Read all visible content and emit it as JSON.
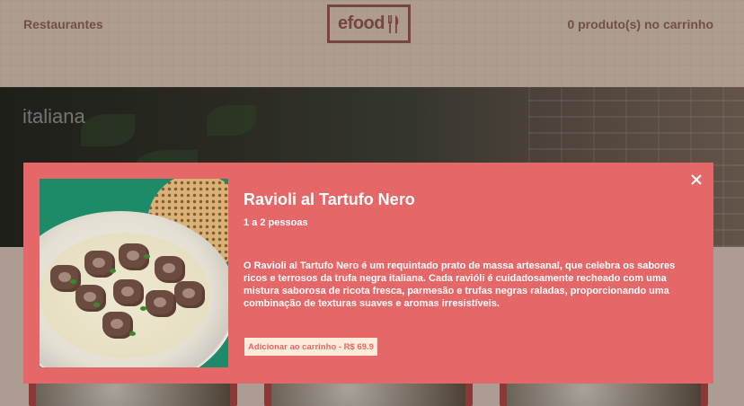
{
  "header": {
    "nav_restaurants": "Restaurantes",
    "logo_text": "efood",
    "cart_label": "0 produto(s) no carrinho"
  },
  "hero": {
    "cuisine": "italiana"
  },
  "modal": {
    "title": "Ravioli al Tartufo Nero",
    "serves": "1 a 2 pessoas",
    "description": "O Ravioli al Tartufo Nero é um requintado prato de massa artesanal, que celebra os sabores ricos e terrosos da trufa negra italiana. Cada ravióli é cuidadosamente recheado com uma mistura saborosa de ricota fresca, parmesão e trufas negras raladas, proporcionando uma combinação de texturas suaves e aromas irresistíveis.",
    "add_button": "Adicionar ao carrinho - R$ 69.9",
    "close_icon": "close-icon"
  },
  "colors": {
    "primary": "#E66767",
    "header_bg": "#F2D9C8",
    "button_bg": "#FFEBD9"
  }
}
